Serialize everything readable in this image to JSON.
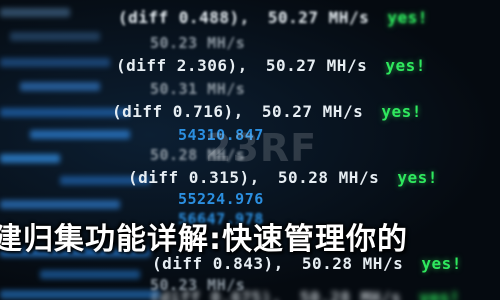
{
  "lines": [
    {
      "mid": "(diff 0.488),",
      "rate": "50.27 MH/s",
      "status": "yes!"
    },
    {
      "sub": "50.23 MH/s"
    },
    {
      "mid": "(diff 2.306),",
      "rate": "50.27 MH/s",
      "status": "yes!"
    },
    {
      "sub": "50.31 MH/s"
    },
    {
      "mid": "(diff 0.716),",
      "rate": "50.27 MH/s",
      "status": "yes!"
    },
    {
      "diffval": "54310.847"
    },
    {
      "sub": "50.28 MH/s"
    },
    {
      "mid": "(diff 0.315),",
      "rate": "50.28 MH/s",
      "status": "yes!"
    },
    {
      "diffval": "55224.976"
    },
    {
      "diffval": "56647.978"
    },
    {
      "mid": "(diff 0.843),",
      "rate": "50.28 MH/s",
      "status": "yes!"
    },
    {
      "sub": "50.23 MH/s"
    },
    {
      "mid": "(diff 0.675),",
      "rate": "50.28 MH/s",
      "status": "yes!"
    }
  ],
  "headline": "建归集功能详解:快速管理你的",
  "watermark": "23RF",
  "colors": {
    "accent": "#2fe85e",
    "text": "#e6edf2",
    "code": "#2b8fe0"
  }
}
